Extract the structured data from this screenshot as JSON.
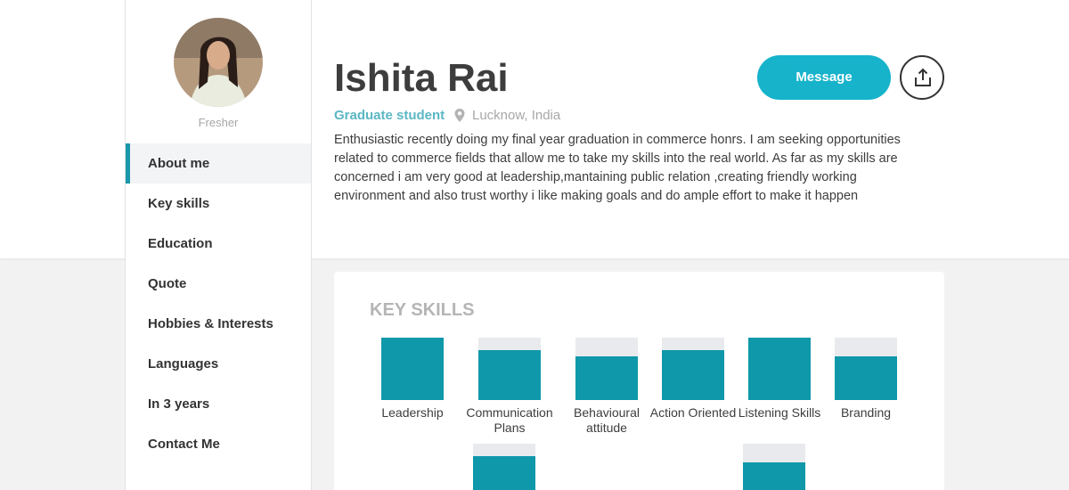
{
  "profile": {
    "name": "Ishita Rai",
    "status": "Fresher",
    "role": "Graduate student",
    "location": "Lucknow, India",
    "bio": "Enthusiastic recently doing my final year graduation in commerce honrs. I am seeking opportunities related to commerce fields that allow me to take my skills into the real world. As far as my skills are concerned i am very good at leadership,mantaining public relation ,creating friendly working environment and also trust worthy i like making goals and do ample effort to make it happen"
  },
  "actions": {
    "message_label": "Message",
    "share_icon": "share-upload-icon"
  },
  "sidebar": {
    "items": [
      {
        "label": "About me",
        "active": true
      },
      {
        "label": "Key skills",
        "active": false
      },
      {
        "label": "Education",
        "active": false
      },
      {
        "label": "Quote",
        "active": false
      },
      {
        "label": "Hobbies & Interests",
        "active": false
      },
      {
        "label": "Languages",
        "active": false
      },
      {
        "label": "In 3 years",
        "active": false
      },
      {
        "label": "Contact Me",
        "active": false
      }
    ]
  },
  "key_skills": {
    "title": "KEY SKILLS",
    "skills": [
      {
        "label": "Leadership",
        "level": 1.0
      },
      {
        "label": "Communication Plans",
        "level": 0.8
      },
      {
        "label": "Behavioural attitude",
        "level": 0.7
      },
      {
        "label": "Action Oriented",
        "level": 0.8
      },
      {
        "label": "Listening Skills",
        "level": 1.0
      },
      {
        "label": "Branding",
        "level": 0.7
      },
      {
        "label": "",
        "level": 0.8
      },
      {
        "label": "",
        "level": 0.7
      }
    ]
  },
  "colors": {
    "accent": "#16b3cb",
    "bar_fill": "#0e98aa",
    "bar_track": "#e9eaed",
    "role_text": "#5bb7c4"
  }
}
